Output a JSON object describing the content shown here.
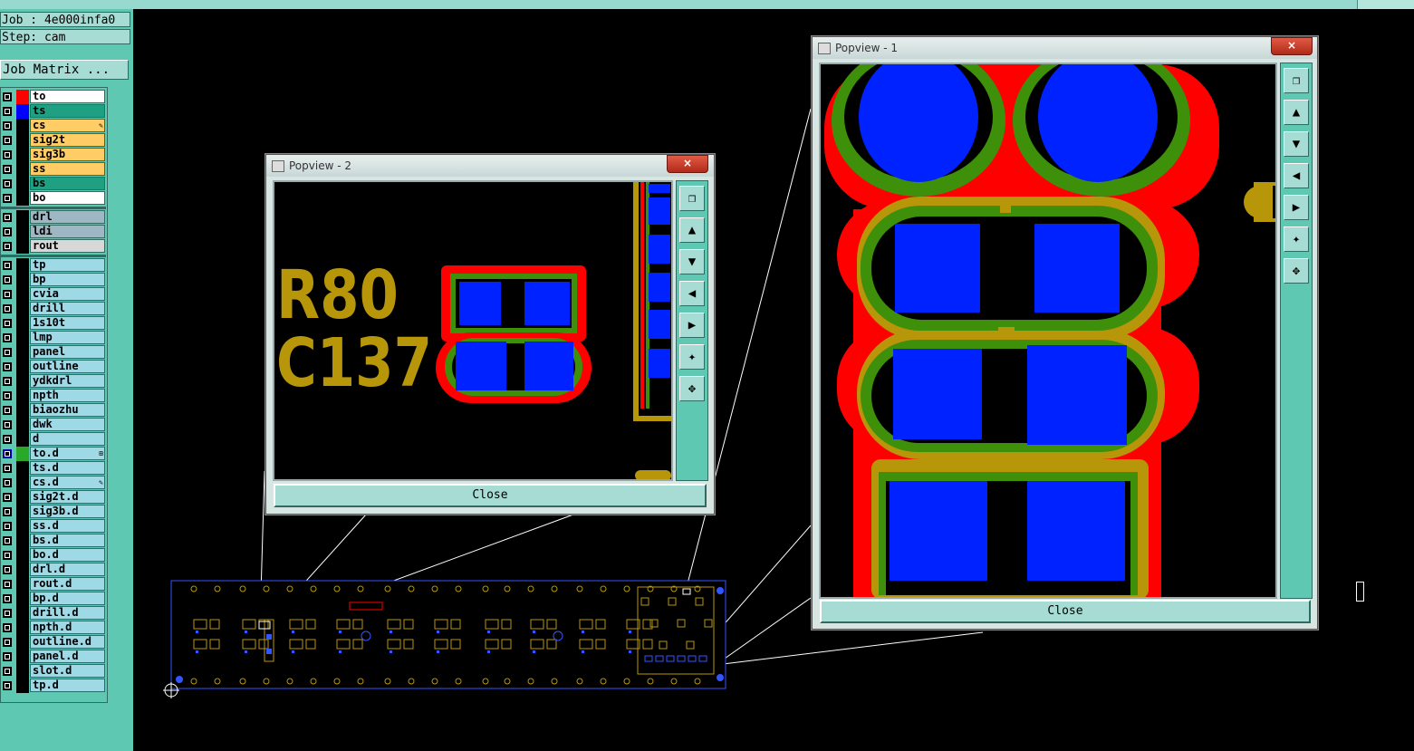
{
  "info": {
    "job": "Job : 4e000infa0",
    "step": "Step: cam",
    "job_matrix": "Job Matrix ..."
  },
  "layers": [
    {
      "name": "to",
      "swatch": "#ff0000",
      "bg": "#ffffff",
      "mark": ""
    },
    {
      "name": "ts",
      "swatch": "#0000ff",
      "bg": "#1fa082",
      "mark": ""
    },
    {
      "name": "cs",
      "swatch": "",
      "bg": "#ffcc66",
      "mark": "edit"
    },
    {
      "name": "sig2t",
      "swatch": "",
      "bg": "#ffcc66",
      "mark": ""
    },
    {
      "name": "sig3b",
      "swatch": "",
      "bg": "#ffcc66",
      "mark": ""
    },
    {
      "name": "ss",
      "swatch": "",
      "bg": "#ffcc66",
      "mark": ""
    },
    {
      "name": "bs",
      "swatch": "",
      "bg": "#1fa082",
      "mark": ""
    },
    {
      "name": "bo",
      "swatch": "",
      "bg": "#ffffff",
      "mark": ""
    },
    {
      "name": "drl",
      "swatch": "",
      "bg": "#9fb7c2",
      "mark": ""
    },
    {
      "name": "ldi",
      "swatch": "",
      "bg": "#9fb7c2",
      "mark": ""
    },
    {
      "name": "rout",
      "swatch": "",
      "bg": "#d8d8d8",
      "mark": ""
    },
    {
      "name": "tp",
      "swatch": "",
      "bg": "#9fd9e6",
      "mark": ""
    },
    {
      "name": "bp",
      "swatch": "",
      "bg": "#9fd9e6",
      "mark": ""
    },
    {
      "name": "cvia",
      "swatch": "",
      "bg": "#9fd9e6",
      "mark": ""
    },
    {
      "name": "drill",
      "swatch": "",
      "bg": "#9fd9e6",
      "mark": ""
    },
    {
      "name": "1s10t",
      "swatch": "",
      "bg": "#9fd9e6",
      "mark": ""
    },
    {
      "name": "lmp",
      "swatch": "",
      "bg": "#9fd9e6",
      "mark": ""
    },
    {
      "name": "panel",
      "swatch": "",
      "bg": "#9fd9e6",
      "mark": ""
    },
    {
      "name": "outline",
      "swatch": "",
      "bg": "#9fd9e6",
      "mark": ""
    },
    {
      "name": "ydkdrl",
      "swatch": "",
      "bg": "#9fd9e6",
      "mark": ""
    },
    {
      "name": "npth",
      "swatch": "",
      "bg": "#9fd9e6",
      "mark": ""
    },
    {
      "name": "biaozhu",
      "swatch": "",
      "bg": "#9fd9e6",
      "mark": ""
    },
    {
      "name": "dwk",
      "swatch": "",
      "bg": "#9fd9e6",
      "mark": ""
    },
    {
      "name": "d",
      "swatch": "",
      "bg": "#9fd9e6",
      "mark": ""
    },
    {
      "name": "to.d",
      "swatch": "#2aa82a",
      "bg": "#9fd9e6",
      "mark": "grid",
      "checked": true
    },
    {
      "name": "ts.d",
      "swatch": "",
      "bg": "#9fd9e6",
      "mark": ""
    },
    {
      "name": "cs.d",
      "swatch": "",
      "bg": "#9fd9e6",
      "mark": "edit"
    },
    {
      "name": "sig2t.d",
      "swatch": "",
      "bg": "#9fd9e6",
      "mark": ""
    },
    {
      "name": "sig3b.d",
      "swatch": "",
      "bg": "#9fd9e6",
      "mark": ""
    },
    {
      "name": "ss.d",
      "swatch": "",
      "bg": "#9fd9e6",
      "mark": ""
    },
    {
      "name": "bs.d",
      "swatch": "",
      "bg": "#9fd9e6",
      "mark": ""
    },
    {
      "name": "bo.d",
      "swatch": "",
      "bg": "#9fd9e6",
      "mark": ""
    },
    {
      "name": "drl.d",
      "swatch": "",
      "bg": "#9fd9e6",
      "mark": ""
    },
    {
      "name": "rout.d",
      "swatch": "",
      "bg": "#9fd9e6",
      "mark": ""
    },
    {
      "name": "bp.d",
      "swatch": "",
      "bg": "#9fd9e6",
      "mark": ""
    },
    {
      "name": "drill.d",
      "swatch": "",
      "bg": "#9fd9e6",
      "mark": ""
    },
    {
      "name": "npth.d",
      "swatch": "",
      "bg": "#9fd9e6",
      "mark": ""
    },
    {
      "name": "outline.d",
      "swatch": "",
      "bg": "#9fd9e6",
      "mark": ""
    },
    {
      "name": "panel.d",
      "swatch": "",
      "bg": "#9fd9e6",
      "mark": ""
    },
    {
      "name": "slot.d",
      "swatch": "",
      "bg": "#9fd9e6",
      "mark": ""
    },
    {
      "name": "tp.d",
      "swatch": "",
      "bg": "#9fd9e6",
      "mark": ""
    }
  ],
  "popview2": {
    "title": "Popview - 2",
    "close_x": "×",
    "close_label": "Close",
    "labels": [
      "R80",
      "C137"
    ]
  },
  "popview1": {
    "title": "Popview - 1",
    "close_x": "×",
    "close_label": "Close"
  },
  "toolbar_icons": [
    "zoom-home-icon",
    "pan-up-icon",
    "pan-down-icon",
    "pan-left-icon",
    "pan-right-icon",
    "zoom-in-icon",
    "zoom-out-icon"
  ],
  "colors": {
    "copper": "#b8960a",
    "mask_green": "#3e8f0a",
    "pad_blue": "#0022ff",
    "outline_red": "#ff0000",
    "panel_bg": "#5ec8b2"
  }
}
